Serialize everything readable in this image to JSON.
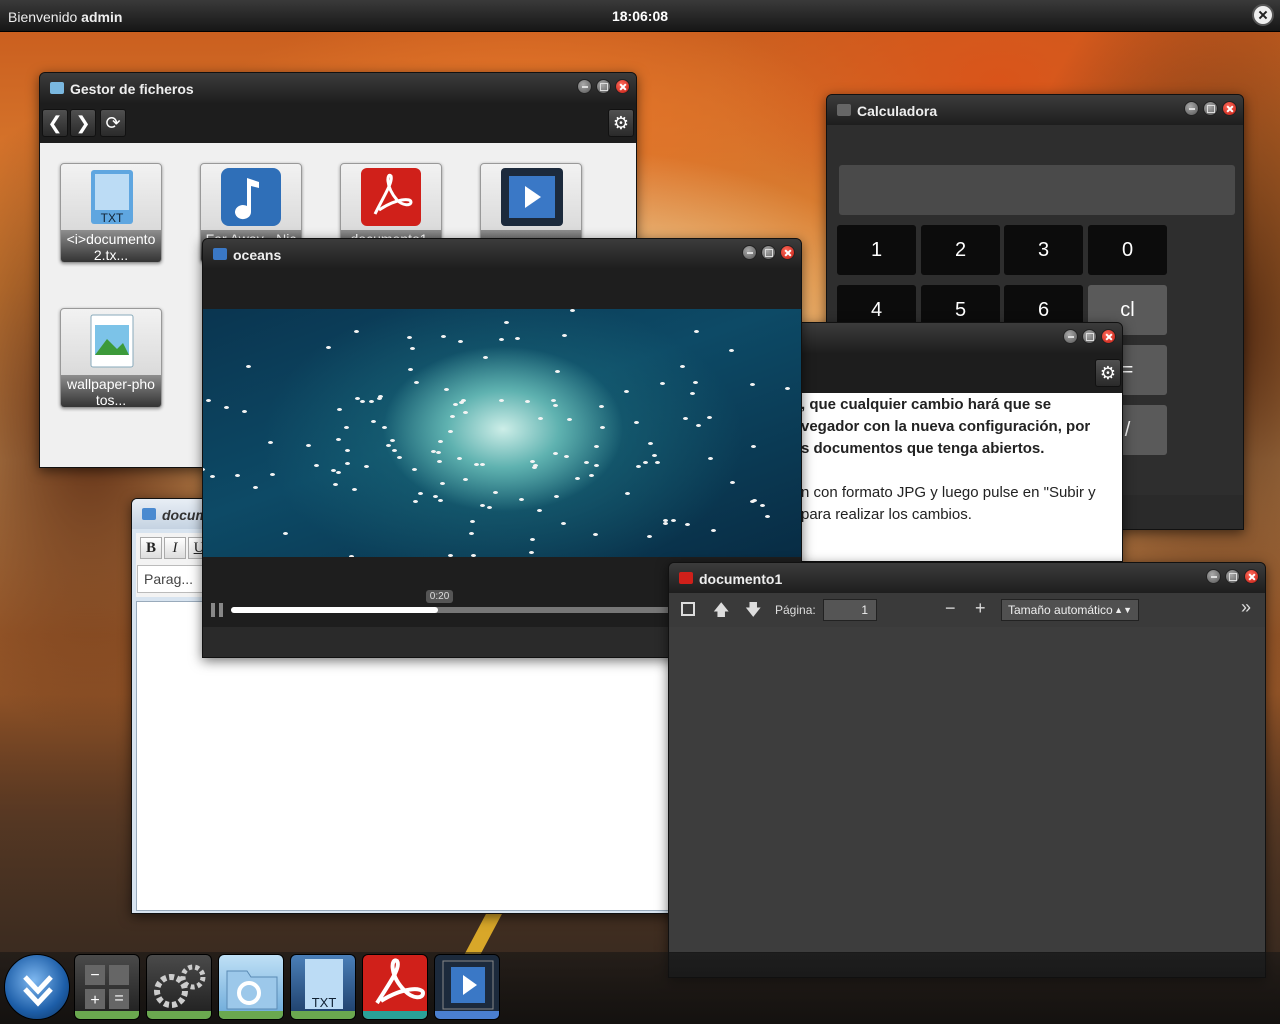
{
  "topbar": {
    "welcome_prefix": "Bienvenido",
    "user": "admin",
    "clock": "18:06:08"
  },
  "file_manager": {
    "title": "Gestor de ficheros",
    "files": [
      {
        "name": "<i>documento 2.tx...",
        "icon": "txt-file-icon"
      },
      {
        "name": "Far Away - Nic",
        "icon": "music-note-icon"
      },
      {
        "name": "documento1.",
        "icon": "pdf-file-icon"
      },
      {
        "name": "",
        "icon": "video-file-icon"
      },
      {
        "name": "wallpaper-pho tos...",
        "icon": "image-file-icon"
      }
    ]
  },
  "calculator": {
    "title": "Calculadora",
    "keys_row1": [
      "1",
      "2",
      "3",
      "0"
    ],
    "keys_row2": [
      "4",
      "5",
      "6",
      "cl"
    ],
    "keys_side": [
      "=",
      "/"
    ]
  },
  "settings_dialog": {
    "text_bold": ", que cualquier cambio hará que se vegador con la nueva configuración, por s documentos que tenga abiertos.",
    "line1": ", que cualquier cambio hará que se",
    "line2": "vegador con la nueva configuración, por",
    "line3": "s documentos que tenga abiertos.",
    "line4": "n con formato JPG y luego pulse en \"Subir y",
    "line5": "para realizar los cambios."
  },
  "video_player": {
    "title": "oceans",
    "time_tooltip": "0:20",
    "progress": 0.47
  },
  "editor": {
    "title": "docum",
    "bold": "B",
    "italic": "I",
    "underline": "U",
    "paragraph": "Parag..."
  },
  "pdf_viewer": {
    "title": "documento1",
    "page_label": "Página:",
    "page_value": "1",
    "zoom_option": "Tamaño automático",
    "minus": "−",
    "plus": "+"
  },
  "dock": {
    "items": [
      {
        "name": "start-menu-icon"
      },
      {
        "name": "calculator-icon"
      },
      {
        "name": "settings-gears-icon"
      },
      {
        "name": "file-manager-icon"
      },
      {
        "name": "txt-editor-icon",
        "label": "TXT"
      },
      {
        "name": "pdf-reader-icon"
      },
      {
        "name": "video-player-icon"
      }
    ]
  },
  "colors": {
    "accent_red": "#d0201a",
    "dock_bar_green": "#6aa84f",
    "dock_bar_teal": "#2aa198"
  }
}
